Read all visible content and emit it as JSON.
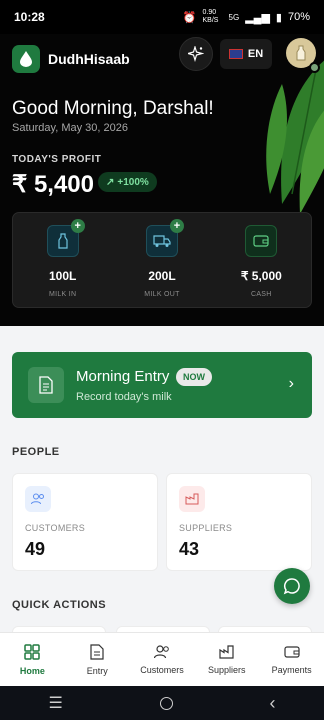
{
  "status_bar": {
    "time": "10:28",
    "battery": "70%",
    "network_speed": "0.90 KB/S",
    "sim": "5G"
  },
  "header": {
    "app_name": "DudhHisaab",
    "language": "EN"
  },
  "hero": {
    "greeting": "Good Morning, Darshal!",
    "date": "Saturday, May 30, 2026",
    "profit_label": "TODAY'S PROFIT",
    "profit_value": "₹ 5,400",
    "trend": "+100%",
    "stats": [
      {
        "value": "100L",
        "label": "MILK IN",
        "icon": "milk-bottle-icon"
      },
      {
        "value": "200L",
        "label": "MILK OUT",
        "icon": "truck-icon"
      },
      {
        "value": "₹ 5,000",
        "label": "CASH",
        "icon": "wallet-icon"
      }
    ]
  },
  "morning_entry": {
    "title": "Morning Entry",
    "badge": "NOW",
    "subtitle": "Record today's milk"
  },
  "people": {
    "title": "PEOPLE",
    "cards": [
      {
        "label": "CUSTOMERS",
        "value": "49",
        "icon": "users-icon",
        "color": "#5b8def"
      },
      {
        "label": "SUPPLIERS",
        "value": "43",
        "icon": "factory-icon",
        "color": "#d65a5a"
      }
    ]
  },
  "quick_actions": {
    "title": "QUICK ACTIONS"
  },
  "bottom_nav": [
    {
      "label": "Home",
      "icon": "home-icon",
      "active": true
    },
    {
      "label": "Entry",
      "icon": "entry-icon",
      "active": false
    },
    {
      "label": "Customers",
      "icon": "customers-icon",
      "active": false
    },
    {
      "label": "Suppliers",
      "icon": "suppliers-icon",
      "active": false
    },
    {
      "label": "Payments",
      "icon": "payments-icon",
      "active": false
    }
  ],
  "colors": {
    "accent": "#1f7a3f",
    "hero_bg": "#050505",
    "page_bg": "#f3f4f6"
  }
}
